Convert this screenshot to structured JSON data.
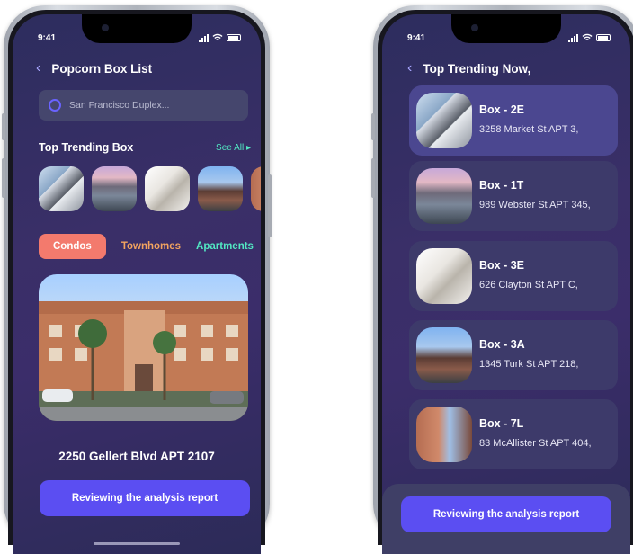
{
  "left": {
    "status_time": "9:41",
    "header_title": "Popcorn Box List",
    "search_placeholder": "San Francisco Duplex...",
    "section_title": "Top Trending Box",
    "see_all": "See All",
    "tabs": [
      "Condos",
      "Townhomes",
      "Apartments"
    ],
    "featured_address": "2250 Gellert Blvd APT 2107",
    "cta": "Reviewing the analysis report"
  },
  "right": {
    "status_time": "9:41",
    "header_title": "Top Trending Now,",
    "items": [
      {
        "name": "Box - 2E",
        "address": "3258 Market St APT 3,"
      },
      {
        "name": "Box - 1T",
        "address": "989 Webster St APT 345,"
      },
      {
        "name": "Box - 3E",
        "address": "626 Clayton St APT C,"
      },
      {
        "name": "Box - 3A",
        "address": "1345 Turk St APT 218,"
      },
      {
        "name": "Box - 7L",
        "address": "83 McAllister St APT 404,"
      }
    ],
    "cta": "Reviewing the analysis report"
  }
}
